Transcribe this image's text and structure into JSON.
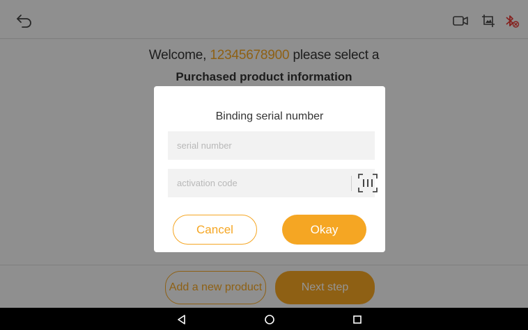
{
  "header": {
    "back_icon": "back-arrow-icon",
    "icons": [
      "video-record-icon",
      "screenshot-icon",
      "bluetooth-disconnected-icon"
    ]
  },
  "main": {
    "welcome_prefix": "Welcome,",
    "phone": "12345678900",
    "welcome_suffix": "please select a",
    "subtitle": "Purchased product information"
  },
  "footer": {
    "add_product_label": "Add a new product",
    "next_step_label": "Next step"
  },
  "dialog": {
    "title": "Binding serial number",
    "serial_placeholder": "serial number",
    "serial_value": "",
    "activation_placeholder": "activation code",
    "activation_value": "",
    "scan_icon": "barcode-scan-icon",
    "cancel_label": "Cancel",
    "okay_label": "Okay"
  },
  "navbar": {
    "icons": [
      "back-triangle-icon",
      "home-circle-icon",
      "recents-square-icon"
    ]
  },
  "colors": {
    "accent": "#f5a623",
    "bluetooth": "#e53935"
  }
}
